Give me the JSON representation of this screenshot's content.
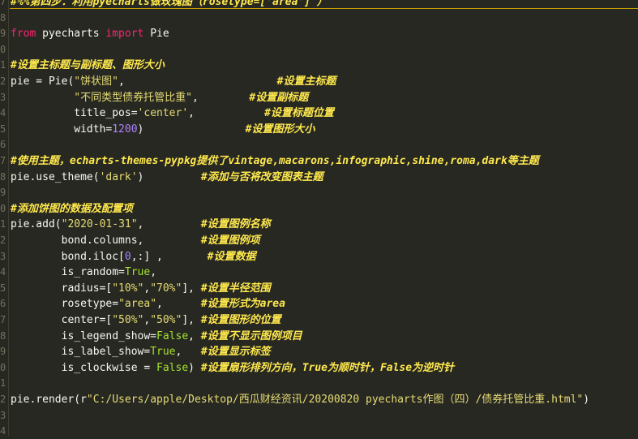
{
  "line_numbers": [
    "7",
    "8",
    "9",
    "0",
    "1",
    "2",
    "3",
    "4",
    "5",
    "6",
    "7",
    "8",
    "9",
    "0",
    "1",
    "2",
    "3",
    "4",
    "5",
    "6",
    "7",
    "8",
    "9",
    "0",
    "1",
    "2",
    "3",
    "4"
  ],
  "colors": {
    "background": "#272822",
    "keyword": "#f92672",
    "string": "#e6db74",
    "number": "#ae81ff",
    "boolean": "#a6e22e",
    "comment": "#ffe94d",
    "text": "#f8f8f2"
  },
  "lines": [
    [
      {
        "t": "cm",
        "v": "#%%第四步：利用pyecharts做玫瑰图（rosetype=['area'] ）"
      }
    ],
    [],
    [
      {
        "t": "kw",
        "v": "from"
      },
      {
        "t": "tx",
        "v": " pyecharts "
      },
      {
        "t": "kw",
        "v": "import"
      },
      {
        "t": "tx",
        "v": " Pie"
      }
    ],
    [],
    [
      {
        "t": "cm",
        "v": "#设置主标题与副标题、图形大小"
      }
    ],
    [
      {
        "t": "tx",
        "v": "pie = Pie("
      },
      {
        "t": "str",
        "v": "\"饼状图\""
      },
      {
        "t": "tx",
        "v": ",                        "
      },
      {
        "t": "cm",
        "v": "#设置主标题"
      }
    ],
    [
      {
        "t": "tx",
        "v": "          "
      },
      {
        "t": "str",
        "v": "\"不同类型债券托管比重\""
      },
      {
        "t": "tx",
        "v": ",        "
      },
      {
        "t": "cm",
        "v": "#设置副标题"
      }
    ],
    [
      {
        "t": "tx",
        "v": "          title_pos="
      },
      {
        "t": "str",
        "v": "'center'"
      },
      {
        "t": "tx",
        "v": ",           "
      },
      {
        "t": "cm",
        "v": "#设置标题位置"
      }
    ],
    [
      {
        "t": "tx",
        "v": "          width="
      },
      {
        "t": "num",
        "v": "1200"
      },
      {
        "t": "tx",
        "v": ")                "
      },
      {
        "t": "cm",
        "v": "#设置图形大小"
      }
    ],
    [],
    [
      {
        "t": "cm",
        "v": "#使用主题，echarts-themes-pypkg提供了vintage,macarons,infographic,shine,roma,dark等主题"
      }
    ],
    [
      {
        "t": "tx",
        "v": "pie.use_theme("
      },
      {
        "t": "str",
        "v": "'dark'"
      },
      {
        "t": "tx",
        "v": ")         "
      },
      {
        "t": "cm",
        "v": "#添加与否将改变图表主题"
      }
    ],
    [],
    [
      {
        "t": "cm",
        "v": "#添加饼图的数据及配置项"
      }
    ],
    [
      {
        "t": "tx",
        "v": "pie.add("
      },
      {
        "t": "str",
        "v": "\"2020-01-31\""
      },
      {
        "t": "tx",
        "v": ",         "
      },
      {
        "t": "cm",
        "v": "#设置图例名称"
      }
    ],
    [
      {
        "t": "tx",
        "v": "        bond.columns,         "
      },
      {
        "t": "cm",
        "v": "#设置图例项"
      }
    ],
    [
      {
        "t": "tx",
        "v": "        bond.iloc["
      },
      {
        "t": "num",
        "v": "0"
      },
      {
        "t": "tx",
        "v": ",:] ,       "
      },
      {
        "t": "cm",
        "v": "#设置数据"
      }
    ],
    [
      {
        "t": "tx",
        "v": "        is_random="
      },
      {
        "t": "bool",
        "v": "True"
      },
      {
        "t": "tx",
        "v": ","
      }
    ],
    [
      {
        "t": "tx",
        "v": "        radius=["
      },
      {
        "t": "str",
        "v": "\"10%\""
      },
      {
        "t": "tx",
        "v": ","
      },
      {
        "t": "str",
        "v": "\"70%\""
      },
      {
        "t": "tx",
        "v": "], "
      },
      {
        "t": "cm",
        "v": "#设置半径范围"
      }
    ],
    [
      {
        "t": "tx",
        "v": "        rosetype="
      },
      {
        "t": "str",
        "v": "\"area\""
      },
      {
        "t": "tx",
        "v": ",      "
      },
      {
        "t": "cm",
        "v": "#设置形式为area"
      }
    ],
    [
      {
        "t": "tx",
        "v": "        center=["
      },
      {
        "t": "str",
        "v": "\"50%\""
      },
      {
        "t": "tx",
        "v": ","
      },
      {
        "t": "str",
        "v": "\"50%\""
      },
      {
        "t": "tx",
        "v": "], "
      },
      {
        "t": "cm",
        "v": "#设置图形的位置"
      }
    ],
    [
      {
        "t": "tx",
        "v": "        is_legend_show="
      },
      {
        "t": "bool",
        "v": "False"
      },
      {
        "t": "tx",
        "v": ", "
      },
      {
        "t": "cm",
        "v": "#设置不显示图例项目"
      }
    ],
    [
      {
        "t": "tx",
        "v": "        is_label_show="
      },
      {
        "t": "bool",
        "v": "True"
      },
      {
        "t": "tx",
        "v": ",   "
      },
      {
        "t": "cm",
        "v": "#设置显示标签"
      }
    ],
    [
      {
        "t": "tx",
        "v": "        is_clockwise = "
      },
      {
        "t": "bool",
        "v": "False"
      },
      {
        "t": "tx",
        "v": ") "
      },
      {
        "t": "cm",
        "v": "#设置扇形排列方向，True为顺时针，False为逆时针"
      }
    ],
    [],
    [
      {
        "t": "tx",
        "v": "pie.render(r"
      },
      {
        "t": "str",
        "v": "\"C:/Users/apple/Desktop/西瓜财经资讯/20200820 pyecharts作图（四）/债券托管比重.html\""
      },
      {
        "t": "tx",
        "v": ")"
      }
    ],
    [],
    []
  ]
}
